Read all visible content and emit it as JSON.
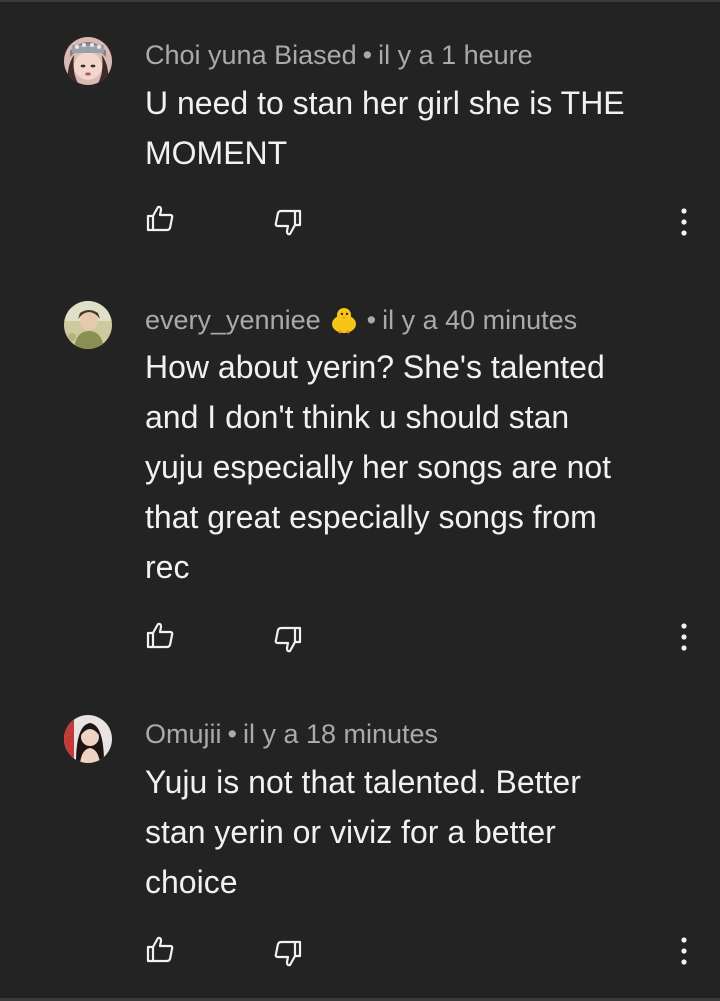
{
  "comments": [
    {
      "author": "Choi yuna Biased",
      "separator": "•",
      "time": "il y a 1 heure",
      "text": "U need to stan her girl she is THE\nMOMENT",
      "avatar_icon": "avatar-doll-headpiece",
      "like_icon": "thumb-up-outline-icon",
      "dislike_icon": "thumb-down-outline-icon",
      "more_icon": "vertical-ellipsis-icon"
    },
    {
      "author": "every_yenniee",
      "author_emoji": "baby-chick-emoji",
      "separator": "•",
      "time": "il y a 40 minutes",
      "text": "How about yerin? She's talented\nand I don't think u should stan\nyuju especially her songs are not\nthat great especially songs from\nrec",
      "avatar_icon": "avatar-portrait",
      "like_icon": "thumb-up-outline-icon",
      "dislike_icon": "thumb-down-outline-icon",
      "more_icon": "vertical-ellipsis-icon"
    },
    {
      "author": "Omujii",
      "separator": "•",
      "time": "il y a 18 minutes",
      "text": "Yuju is not that talented. Better\nstan yerin or viviz for a better\nchoice",
      "avatar_icon": "avatar-portrait",
      "like_icon": "thumb-up-outline-icon",
      "dislike_icon": "thumb-down-outline-icon",
      "more_icon": "vertical-ellipsis-icon"
    }
  ],
  "colors": {
    "background": "#232323",
    "primary_text": "#f1f1f1",
    "secondary_text": "#aaaaaa"
  }
}
